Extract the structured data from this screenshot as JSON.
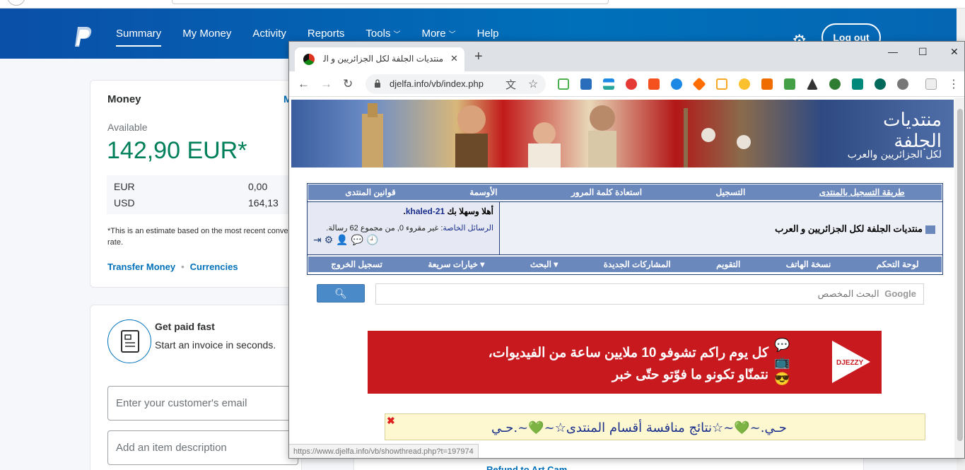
{
  "paypal": {
    "nav": [
      {
        "label": "Summary"
      },
      {
        "label": "My Money"
      },
      {
        "label": "Activity"
      },
      {
        "label": "Reports"
      },
      {
        "label": "Tools"
      },
      {
        "label": "More"
      },
      {
        "label": "Help"
      }
    ],
    "logout_label": "Log out",
    "money": {
      "title": "Money",
      "more_link": "M",
      "available_label": "Available",
      "balance": "142,90 EUR*",
      "currencies": [
        {
          "code": "EUR",
          "amount": "0,00"
        },
        {
          "code": "USD",
          "amount": "164,13"
        }
      ],
      "estimate_line1": "*This is an estimate based on the most recent conve",
      "estimate_line2": "rate.",
      "link_transfer": "Transfer Money",
      "link_currencies": "Currencies"
    },
    "invoice": {
      "title": "Get paid fast",
      "subtitle": "Start an invoice in seconds.",
      "email_placeholder": "Enter your customer's email",
      "item_placeholder": "Add an item description"
    },
    "bottom_link": "Refund to Art Cam"
  },
  "browser": {
    "tab_title": "منتديات الجلفة لكل الجزائريين و العرب",
    "url": "djelfa.info/vb/index.php",
    "status_url": "https://www.djelfa.info/vb/showthread.php?t=197974"
  },
  "forum": {
    "banner_title": "منتديات الجلفة",
    "banner_subtitle": "لكل الجزائريين والعرب",
    "top_nav": [
      {
        "label": "طريقة التسجيل بالمنتدى",
        "underline": true
      },
      {
        "label": "التسجيل"
      },
      {
        "label": "استعادة كلمة المرور"
      },
      {
        "label": "الأوسمة"
      },
      {
        "label": "قوانين المنتدى"
      }
    ],
    "forum_name": "منتديات الجلفة لكل الجزائريين و العرب",
    "welcome_prefix": "أهلا وسهلا بك",
    "username": "khaled-21",
    "pm_label": "الرسائل الخاصة",
    "pm_text": ": غير مقروء 0, من مجموع 62 رسالة.",
    "bottom_nav": [
      {
        "label": "لوحة التحكم"
      },
      {
        "label": "نسخة الهاتف"
      },
      {
        "label": "التقويم"
      },
      {
        "label": "المشاركات الجديدة"
      },
      {
        "label": "البحث ▾"
      },
      {
        "label": "خيارات سريعة ▾"
      },
      {
        "label": "تسجيل الخروج"
      }
    ],
    "search_brand": "Google",
    "search_placeholder": "البحث المخصص",
    "ad_line1": "كل يوم راكم تشوفو 10 ملايين ساعة من الفيديوات،",
    "ad_line2": "نتمنّاو تكونو ما فوّتو حتّى خبر",
    "ad_brand": "DJEZZY",
    "notice_text": "حـي.~💚~☆نتائج منافسة أقسام المنتدى☆~💚~.حـي"
  },
  "colors": {
    "paypal_blue": "#0070ba",
    "balance_green": "#00805a",
    "forum_nav": "#6b88bd",
    "ad_red": "#c8191f"
  }
}
